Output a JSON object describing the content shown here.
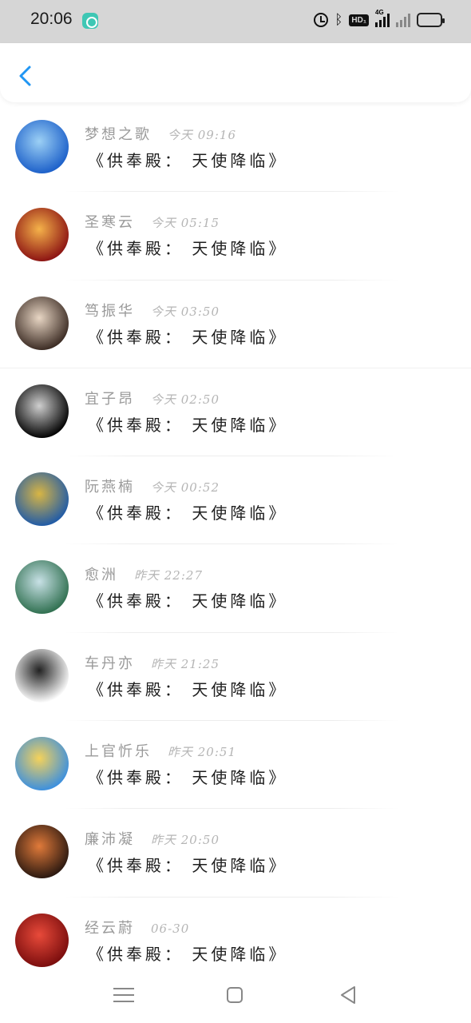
{
  "status_bar": {
    "time": "20:06",
    "icons": [
      "chat-app-icon",
      "alarm-icon",
      "bluetooth-icon",
      "hd-icon",
      "signal-4g-icon",
      "signal-icon",
      "battery-icon"
    ],
    "hd_label": "HD₁",
    "signal_label": "4G",
    "battery_color": "#f2c94c"
  },
  "header": {
    "back_icon": "chevron-left-icon",
    "accent": "#2196f3"
  },
  "messages": [
    {
      "name": "梦想之歌",
      "time": "今天 09:16",
      "text": "《供奉殿： 天使降临》",
      "avatar_colors": [
        "#1b5fc9",
        "#9cd0f5"
      ]
    },
    {
      "name": "圣寒云",
      "time": "今天 05:15",
      "text": "《供奉殿： 天使降临》",
      "avatar_colors": [
        "#8b1212",
        "#f5b24a"
      ]
    },
    {
      "name": "笃振华",
      "time": "今天 03:50",
      "text": "《供奉殿： 天使降临》",
      "avatar_colors": [
        "#3a2a22",
        "#e8d6c4"
      ]
    },
    {
      "name": "宜子昂",
      "time": "今天 02:50",
      "text": "《供奉殿： 天使降临》",
      "avatar_colors": [
        "#000000",
        "#cfcfcf"
      ]
    },
    {
      "name": "阮燕楠",
      "time": "今天 00:52",
      "text": "《供奉殿： 天使降临》",
      "avatar_colors": [
        "#1e5aa8",
        "#d8b544"
      ]
    },
    {
      "name": "愈洲",
      "time": "昨天 22:27",
      "text": "《供奉殿： 天使降临》",
      "avatar_colors": [
        "#2f6f4f",
        "#c8e1e6"
      ]
    },
    {
      "name": "车丹亦",
      "time": "昨天 21:25",
      "text": "《供奉殿： 天使降临》",
      "avatar_colors": [
        "#ffffff",
        "#222222"
      ]
    },
    {
      "name": "上官忻乐",
      "time": "昨天 20:51",
      "text": "《供奉殿： 天使降临》",
      "avatar_colors": [
        "#3a8fe0",
        "#f5d25a"
      ]
    },
    {
      "name": "廉沛凝",
      "time": "昨天 20:50",
      "text": "《供奉殿： 天使降临》",
      "avatar_colors": [
        "#2a1810",
        "#e07a3a"
      ]
    },
    {
      "name": "经云蔚",
      "time": "06-30",
      "text": "《供奉殿： 天使降临》",
      "avatar_colors": [
        "#7a0d0d",
        "#e84a3a"
      ]
    }
  ],
  "nav_bar": {
    "icons": [
      "menu-icon",
      "home-icon",
      "back-triangle-icon"
    ]
  }
}
